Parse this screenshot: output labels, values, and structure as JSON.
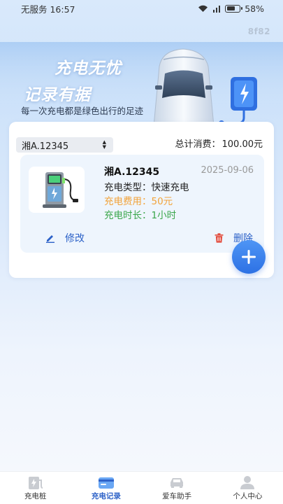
{
  "status": {
    "left": "无服务 16:57",
    "battery": "58%"
  },
  "corner_code": "8f82",
  "banner": {
    "slogan_line1": "充电无忧",
    "slogan_line2": "记录有据",
    "subtitle": "每一次充电都是绿色出行的足迹"
  },
  "filter": {
    "selected_plate": "湘A.12345"
  },
  "summary": {
    "label": "总计消费：",
    "amount": "100.00元"
  },
  "records": [
    {
      "plate": "湘A.12345",
      "date": "2025-09-06",
      "type_text": "充电类型：快速充电",
      "cost_text": "充电费用：50元",
      "duration_text": "充电时长：1小时",
      "edit_label": "修改",
      "delete_label": "删除"
    }
  ],
  "tabs": [
    {
      "label": "充电桩",
      "icon": "charger-icon",
      "active": false
    },
    {
      "label": "充电记录",
      "icon": "record-card-icon",
      "active": true
    },
    {
      "label": "爱车助手",
      "icon": "car-icon",
      "active": false
    },
    {
      "label": "个人中心",
      "icon": "person-icon",
      "active": false
    }
  ],
  "colors": {
    "accent": "#2d62c8",
    "cost": "#f2a33a",
    "duration": "#3aa64a",
    "delete": "#e24a3b"
  }
}
